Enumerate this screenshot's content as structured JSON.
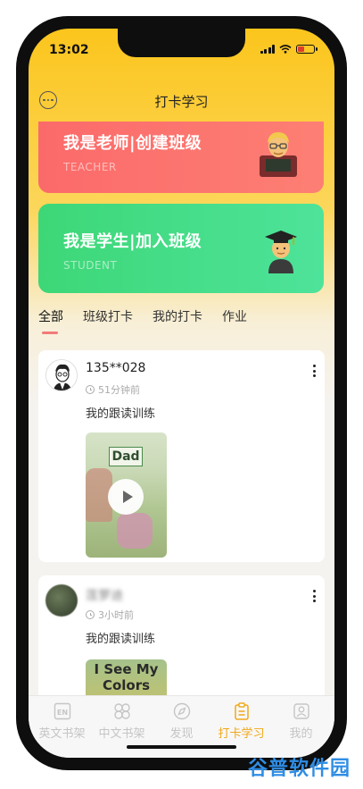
{
  "status": {
    "time": "13:02"
  },
  "nav": {
    "title": "打卡学习"
  },
  "roles": {
    "teacher": {
      "title": "我是老师|创建班级",
      "subtitle": "TEACHER"
    },
    "student": {
      "title": "我是学生|加入班级",
      "subtitle": "STUDENT"
    }
  },
  "tabs": [
    {
      "label": "全部",
      "active": true
    },
    {
      "label": "班级打卡",
      "active": false
    },
    {
      "label": "我的打卡",
      "active": false
    },
    {
      "label": "作业",
      "active": false
    }
  ],
  "posts": [
    {
      "username": "135**028",
      "time": "51分钟前",
      "text": "我的跟读训练",
      "cover_label": "Dad"
    },
    {
      "username": "莲萝迪",
      "time": "3小时前",
      "text": "我的跟读训练",
      "cover_label": "I See My Colors"
    }
  ],
  "tabbar": [
    {
      "label": "英文书架",
      "icon": "en-book-icon",
      "active": false
    },
    {
      "label": "中文书架",
      "icon": "grid-book-icon",
      "active": false
    },
    {
      "label": "发现",
      "icon": "compass-icon",
      "active": false
    },
    {
      "label": "打卡学习",
      "icon": "clipboard-icon",
      "active": true
    },
    {
      "label": "我的",
      "icon": "profile-icon",
      "active": false
    }
  ],
  "watermark": {
    "text": "谷普软件园"
  },
  "colors": {
    "accent": "#f0a81a",
    "teacher": "#fb6a6a",
    "student": "#3dd777",
    "header": "#fbc51c"
  }
}
